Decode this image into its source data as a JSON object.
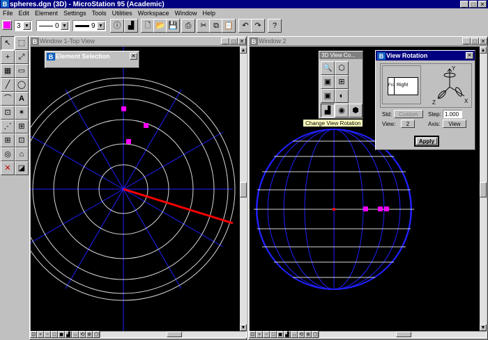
{
  "app": {
    "title": "spheres.dgn (3D) - MicroStation 95 (Academic)",
    "logo_letter": "B",
    "title_buttons": [
      "_",
      "□",
      "✕"
    ]
  },
  "menu": [
    "File",
    "Edit",
    "Element",
    "Settings",
    "Tools",
    "Utilities",
    "Workspace",
    "Window",
    "Help"
  ],
  "toolbar": {
    "active_color": "#ff00ff",
    "level_value": "3",
    "line_style_value": "0",
    "line_weight_value": "9",
    "icons": [
      "info-icon",
      "attributes-icon",
      "new-file-icon",
      "open-file-icon",
      "save-icon",
      "print-icon",
      "cut-icon",
      "copy-icon",
      "paste-icon",
      "undo-icon",
      "redo-icon",
      "help-icon"
    ],
    "glyphs": {
      "info": "ⓘ",
      "attributes": "▟",
      "new": "🗋",
      "open": "📂",
      "save": "💾",
      "print": "⎙",
      "cut": "✂",
      "copy": "⧉",
      "paste": "📋",
      "undo": "↶",
      "redo": "↷",
      "help": "?"
    }
  },
  "palette": {
    "glyphs": [
      "↖",
      "⬚",
      "+",
      "⤢",
      "▦",
      "▭",
      "╱",
      "◯",
      "⌒",
      "A",
      "⊡",
      "✶",
      "⋰",
      "⊞",
      "⊞",
      "⊡",
      "◎",
      "⌂",
      "✕",
      "◪"
    ]
  },
  "window1": {
    "title": "Window 1-Top View",
    "controls": [
      "_",
      "□",
      "✕"
    ],
    "view_controls": [
      "⊡",
      "+",
      "−",
      "□",
      "◼",
      "▟",
      "↔",
      "⟲",
      "⊕",
      "⬡"
    ]
  },
  "window2": {
    "title": "Window 2",
    "controls": [
      "_",
      "□",
      "✕"
    ],
    "view_controls": [
      "⊡",
      "+",
      "−",
      "□",
      "◼",
      "▟",
      "↔",
      "⟲",
      "⊕",
      "⬡"
    ]
  },
  "element_selection": {
    "title": "Element Selection"
  },
  "view_control": {
    "title": "3D View Co...",
    "tooltip": "Change View Rotation",
    "glyphs": [
      "🔍",
      "⬡",
      "▣",
      "⊞",
      "▣",
      "◐",
      "▟",
      "◉",
      "⬢"
    ]
  },
  "view_rotation": {
    "title": "View Rotation",
    "front_label": "Fro",
    "right_label": "Right",
    "std_label": "Std:",
    "std_value": "Custom",
    "view_label": "View:",
    "view_value": "2",
    "step_label": "Step:",
    "step_value": "1.000",
    "axis_label": "Axis:",
    "axis_value": "View",
    "axis_letters": [
      "Y",
      "X",
      "Z"
    ],
    "apply_label": "Apply"
  },
  "colors": {
    "view_bg": "#000000",
    "grid_line": "#d8d8d8",
    "construction_line": "#2020ff",
    "highlight_line": "#ff0000",
    "marker": "#ff00ff",
    "title_bar": "#000080",
    "tooltip_bg": "#ffffc0"
  }
}
